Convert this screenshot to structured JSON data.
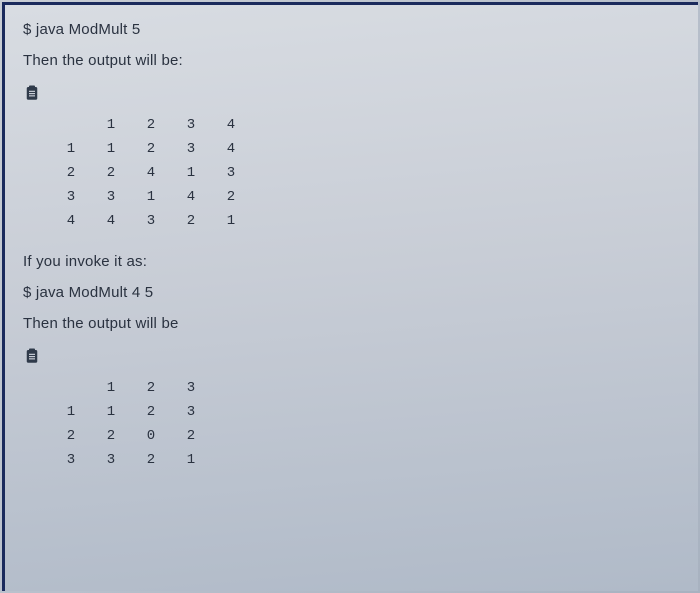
{
  "cmd1": "$ java ModMult 5",
  "then1": "Then the output will be:",
  "invoke2": "If you invoke it as:",
  "cmd2": "$ java ModMult 4 5",
  "then2": "Then the output will be",
  "table1": {
    "header": [
      "",
      "1",
      "2",
      "3",
      "4"
    ],
    "rows": [
      [
        "1",
        "1",
        "2",
        "3",
        "4"
      ],
      [
        "2",
        "2",
        "4",
        "1",
        "3"
      ],
      [
        "3",
        "3",
        "1",
        "4",
        "2"
      ],
      [
        "4",
        "4",
        "3",
        "2",
        "1"
      ]
    ]
  },
  "table2": {
    "header": [
      "",
      "1",
      "2",
      "3"
    ],
    "rows": [
      [
        "1",
        "1",
        "2",
        "3"
      ],
      [
        "2",
        "2",
        "0",
        "2"
      ],
      [
        "3",
        "3",
        "2",
        "1"
      ]
    ]
  }
}
